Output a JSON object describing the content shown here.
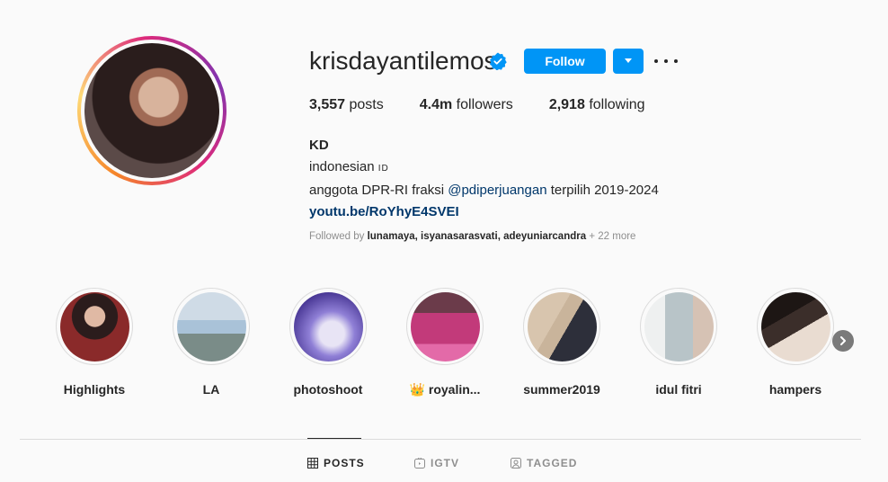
{
  "profile": {
    "username": "krisdayantilemos",
    "follow_label": "Follow",
    "stats": {
      "posts_count": "3,557",
      "posts_label": "posts",
      "followers_count": "4.4m",
      "followers_label": "followers",
      "following_count": "2,918",
      "following_label": "following"
    },
    "bio": {
      "name": "KD",
      "line1": "indonesian",
      "flag": "ID",
      "line2_prefix": "anggota DPR-RI fraksi",
      "line2_mention": "@pdiperjuangan",
      "line2_suffix": "terpilih 2019-2024",
      "link": "youtu.be/RoYhyE4SVEI"
    },
    "followed_by": {
      "prefix": "Followed by",
      "names": "lunamaya, isyanasarasvati, adeyuniarcandra",
      "more": "+ 22 more"
    }
  },
  "highlights": [
    {
      "label": "Highlights",
      "color": "#8a2a2a"
    },
    {
      "label": "LA",
      "color": "#a9c2d8"
    },
    {
      "label": "photoshoot",
      "color": "#8f7fd6"
    },
    {
      "label": "👑 royalin...",
      "color": "#c23a7a"
    },
    {
      "label": "summer2019",
      "color": "#c9b49b"
    },
    {
      "label": "idul fitri",
      "color": "#b8c4c8"
    },
    {
      "label": "hampers",
      "color": "#3b2e2a"
    }
  ],
  "tabs": [
    {
      "label": "POSTS",
      "icon": "grid-icon",
      "active": true
    },
    {
      "label": "IGTV",
      "icon": "igtv-icon",
      "active": false
    },
    {
      "label": "TAGGED",
      "icon": "tagged-icon",
      "active": false
    }
  ],
  "colors": {
    "accent": "#0095f6",
    "link": "#00376b",
    "muted": "#8e8e8e"
  }
}
